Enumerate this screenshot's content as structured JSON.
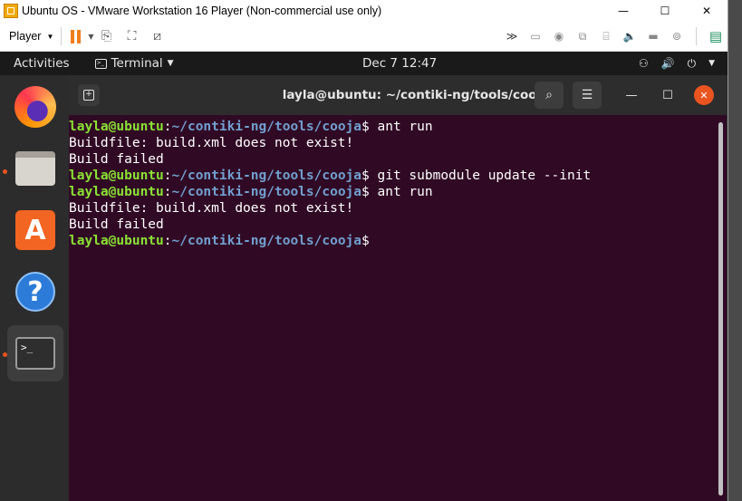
{
  "vmware": {
    "title": "Ubuntu OS - VMware Workstation 16 Player (Non-commercial use only)",
    "player_menu": "Player",
    "minimize": "—",
    "maximize": "☐",
    "close": "✕"
  },
  "ubuntu_topbar": {
    "activities": "Activities",
    "app_menu": "Terminal",
    "clock": "Dec 7  12:47"
  },
  "terminal": {
    "title": "layla@ubuntu: ~/contiki-ng/tools/cooja",
    "lines": [
      {
        "type": "prompt",
        "user": "layla@ubuntu",
        "path": "~/contiki-ng/tools/cooja",
        "cmd": " ant run"
      },
      {
        "type": "output",
        "text": "Buildfile: build.xml does not exist!"
      },
      {
        "type": "output",
        "text": "Build failed"
      },
      {
        "type": "prompt",
        "user": "layla@ubuntu",
        "path": "~/contiki-ng/tools/cooja",
        "cmd": " git submodule update --init"
      },
      {
        "type": "prompt",
        "user": "layla@ubuntu",
        "path": "~/contiki-ng/tools/cooja",
        "cmd": " ant run"
      },
      {
        "type": "output",
        "text": "Buildfile: build.xml does not exist!"
      },
      {
        "type": "output",
        "text": "Build failed"
      },
      {
        "type": "prompt",
        "user": "layla@ubuntu",
        "path": "~/contiki-ng/tools/cooja",
        "cmd": ""
      }
    ]
  },
  "dock": {
    "items": [
      "firefox-icon",
      "files-icon",
      "software-store-icon",
      "help-icon",
      "terminal-icon"
    ]
  },
  "colors": {
    "terminal_bg": "#300a24",
    "prompt_user": "#8ae234",
    "prompt_path": "#729fcf",
    "accent": "#e95420"
  }
}
